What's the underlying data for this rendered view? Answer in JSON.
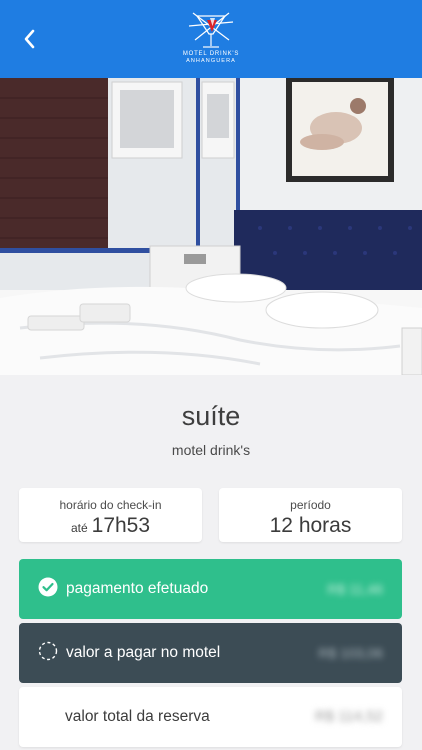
{
  "header": {
    "back_label": "voltar",
    "logo_line1": "MOTEL DRINK'S",
    "logo_line2": "ANHANGUERA",
    "color": "#1f7de2"
  },
  "photo": {
    "alt": "suíte"
  },
  "suite": {
    "name": "suíte",
    "motel": "motel drink's"
  },
  "checkin": {
    "label": "horário do check-in",
    "prefix": "até",
    "time": "17h53"
  },
  "period": {
    "label": "período",
    "value": "12 horas"
  },
  "payments": [
    {
      "label": "pagamento efetuado",
      "amount": "R$ 11,46",
      "icon": "check-circle-icon",
      "color": "#2fbf8c"
    },
    {
      "label": "valor a pagar no motel",
      "amount": "R$ 103,06",
      "icon": "dashed-circle-icon",
      "color": "#3c4c55"
    },
    {
      "label": "valor total da reserva",
      "amount": "R$ 114,52",
      "icon": "",
      "color": "#ffffff"
    }
  ]
}
